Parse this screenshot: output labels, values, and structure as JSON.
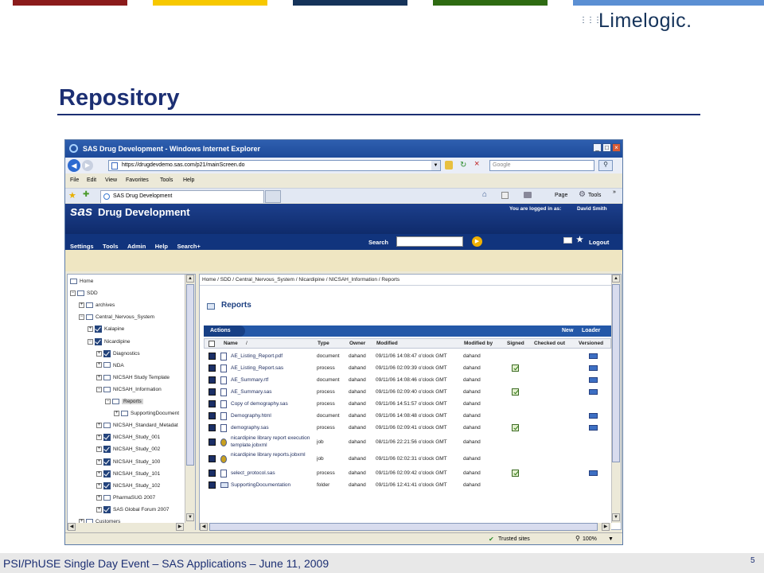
{
  "colors": {
    "bar1": "#8b1b1b",
    "bar2": "#f7c800",
    "bar3": "#15335a",
    "bar4": "#2e6b12",
    "bar5": "#5b8fd3",
    "title": "#1c2f73"
  },
  "logo": {
    "text": "Limelogic."
  },
  "slide": {
    "title": "Repository",
    "footer": "PSI/PhUSE Single Day Event – SAS Applications – June 11, 2009",
    "page": "5"
  },
  "browser": {
    "title": "SAS Drug Development - Windows Internet Explorer",
    "url": "https://drugdevdemo.sas.com/p21/mainScreen.do",
    "search_placeholder": "Google",
    "menu": [
      "File",
      "Edit",
      "View",
      "Favorites",
      "Tools",
      "Help"
    ],
    "tab": "SAS Drug Development",
    "cmd": {
      "page": "Page",
      "tools": "Tools"
    },
    "status_zone": "Trusted sites",
    "zoom": "100%"
  },
  "sas": {
    "brand": "sas",
    "app": "Drug Development",
    "logged_in_label": "You are logged in as:",
    "user": "David Smith",
    "menu": [
      "Settings",
      "Tools",
      "Admin",
      "Help",
      "Search+"
    ],
    "search_label": "Search",
    "logout": "Logout"
  },
  "tree": [
    {
      "label": "Home",
      "indent": 0,
      "type": "folder",
      "box": ""
    },
    {
      "label": "SDD",
      "indent": 0,
      "type": "folder",
      "box": "−"
    },
    {
      "label": "archives",
      "indent": 1,
      "type": "folder",
      "box": "+"
    },
    {
      "label": "Central_Nervous_System",
      "indent": 1,
      "type": "folder",
      "box": "−"
    },
    {
      "label": "Kalapine",
      "indent": 2,
      "type": "check",
      "box": "+"
    },
    {
      "label": "Nicardipine",
      "indent": 2,
      "type": "check",
      "box": "−"
    },
    {
      "label": "Diagnostics",
      "indent": 3,
      "type": "check",
      "box": "+"
    },
    {
      "label": "NDA",
      "indent": 3,
      "type": "folder",
      "box": "+"
    },
    {
      "label": "NICSAH Study Template",
      "indent": 3,
      "type": "folder",
      "box": "+"
    },
    {
      "label": "NICSAH_Information",
      "indent": 3,
      "type": "folder",
      "box": "−"
    },
    {
      "label": "Reports",
      "indent": 4,
      "type": "folder",
      "box": "−",
      "selected": true
    },
    {
      "label": "SupportingDocument",
      "indent": 5,
      "type": "folder",
      "box": "+"
    },
    {
      "label": "NICSAH_Standard_Metadat",
      "indent": 3,
      "type": "folder",
      "box": "+"
    },
    {
      "label": "NICSAH_Study_001",
      "indent": 3,
      "type": "check",
      "box": "+"
    },
    {
      "label": "NICSAH_Study_002",
      "indent": 3,
      "type": "check",
      "box": "+"
    },
    {
      "label": "NICSAH_Study_100",
      "indent": 3,
      "type": "check",
      "box": "+"
    },
    {
      "label": "NICSAH_Study_101",
      "indent": 3,
      "type": "check",
      "box": "+"
    },
    {
      "label": "NICSAH_Study_102",
      "indent": 3,
      "type": "check",
      "box": "+"
    },
    {
      "label": "PharmaSUG 2007",
      "indent": 3,
      "type": "folder",
      "box": "+"
    },
    {
      "label": "SAS Global Forum 2007",
      "indent": 3,
      "type": "check",
      "box": "+"
    },
    {
      "label": "Customers",
      "indent": 1,
      "type": "folder",
      "box": "+"
    }
  ],
  "main": {
    "breadcrumb": "Home / SDD / Central_Nervous_System / Nicardipine / NICSAH_Information / Reports",
    "heading": "Reports",
    "actions": "Actions",
    "new": "New",
    "loader": "Loader",
    "columns": [
      "Name",
      "Type",
      "Owner",
      "Modified",
      "Modified by",
      "Signed",
      "Checked out",
      "Versioned"
    ],
    "rows": [
      {
        "name": "AE_Listing_Report.pdf",
        "type": "document",
        "owner": "dahand",
        "modified": "09/11/06 14:08:47 o'clock GMT",
        "by": "dahand",
        "signed": false,
        "versioned": true
      },
      {
        "name": "AE_Listing_Report.sas",
        "type": "process",
        "owner": "dahand",
        "modified": "09/11/06 02:09:39 o'clock GMT",
        "by": "dahand",
        "signed": true,
        "versioned": true
      },
      {
        "name": "AE_Summary.rtf",
        "type": "document",
        "owner": "dahand",
        "modified": "09/11/06 14:08:46 o'clock GMT",
        "by": "dahand",
        "signed": false,
        "versioned": true
      },
      {
        "name": "AE_Summary.sas",
        "type": "process",
        "owner": "dahand",
        "modified": "09/11/06 02:09:40 o'clock GMT",
        "by": "dahand",
        "signed": true,
        "versioned": true
      },
      {
        "name": "Copy of demography.sas",
        "type": "process",
        "owner": "dahand",
        "modified": "09/11/06 14:51:57 o'clock GMT",
        "by": "dahand",
        "signed": false,
        "versioned": false
      },
      {
        "name": "Demography.html",
        "type": "document",
        "owner": "dahand",
        "modified": "09/11/06 14:08:48 o'clock GMT",
        "by": "dahand",
        "signed": false,
        "versioned": true
      },
      {
        "name": "demography.sas",
        "type": "process",
        "owner": "dahand",
        "modified": "09/11/06 02:09:41 o'clock GMT",
        "by": "dahand",
        "signed": true,
        "versioned": true
      },
      {
        "name": "nicardipine library report execution template.jobxml",
        "type": "job",
        "owner": "dahand",
        "modified": "08/11/06 22:21:56 o'clock GMT",
        "by": "dahand",
        "signed": false,
        "versioned": false,
        "tall": true
      },
      {
        "name": "nicardipine library reports.jobxml",
        "type": "job",
        "owner": "dahand",
        "modified": "09/11/06 02:02:31 o'clock GMT",
        "by": "dahand",
        "signed": false,
        "versioned": false,
        "tall": true
      },
      {
        "name": "select_protocol.sas",
        "type": "process",
        "owner": "dahand",
        "modified": "09/11/06 02:09:42 o'clock GMT",
        "by": "dahand",
        "signed": true,
        "versioned": true
      },
      {
        "name": "SupportingDocumentation",
        "type": "folder",
        "owner": "dahand",
        "modified": "09/11/06 12:41:41 o'clock GMT",
        "by": "dahand",
        "signed": false,
        "versioned": false
      }
    ]
  }
}
